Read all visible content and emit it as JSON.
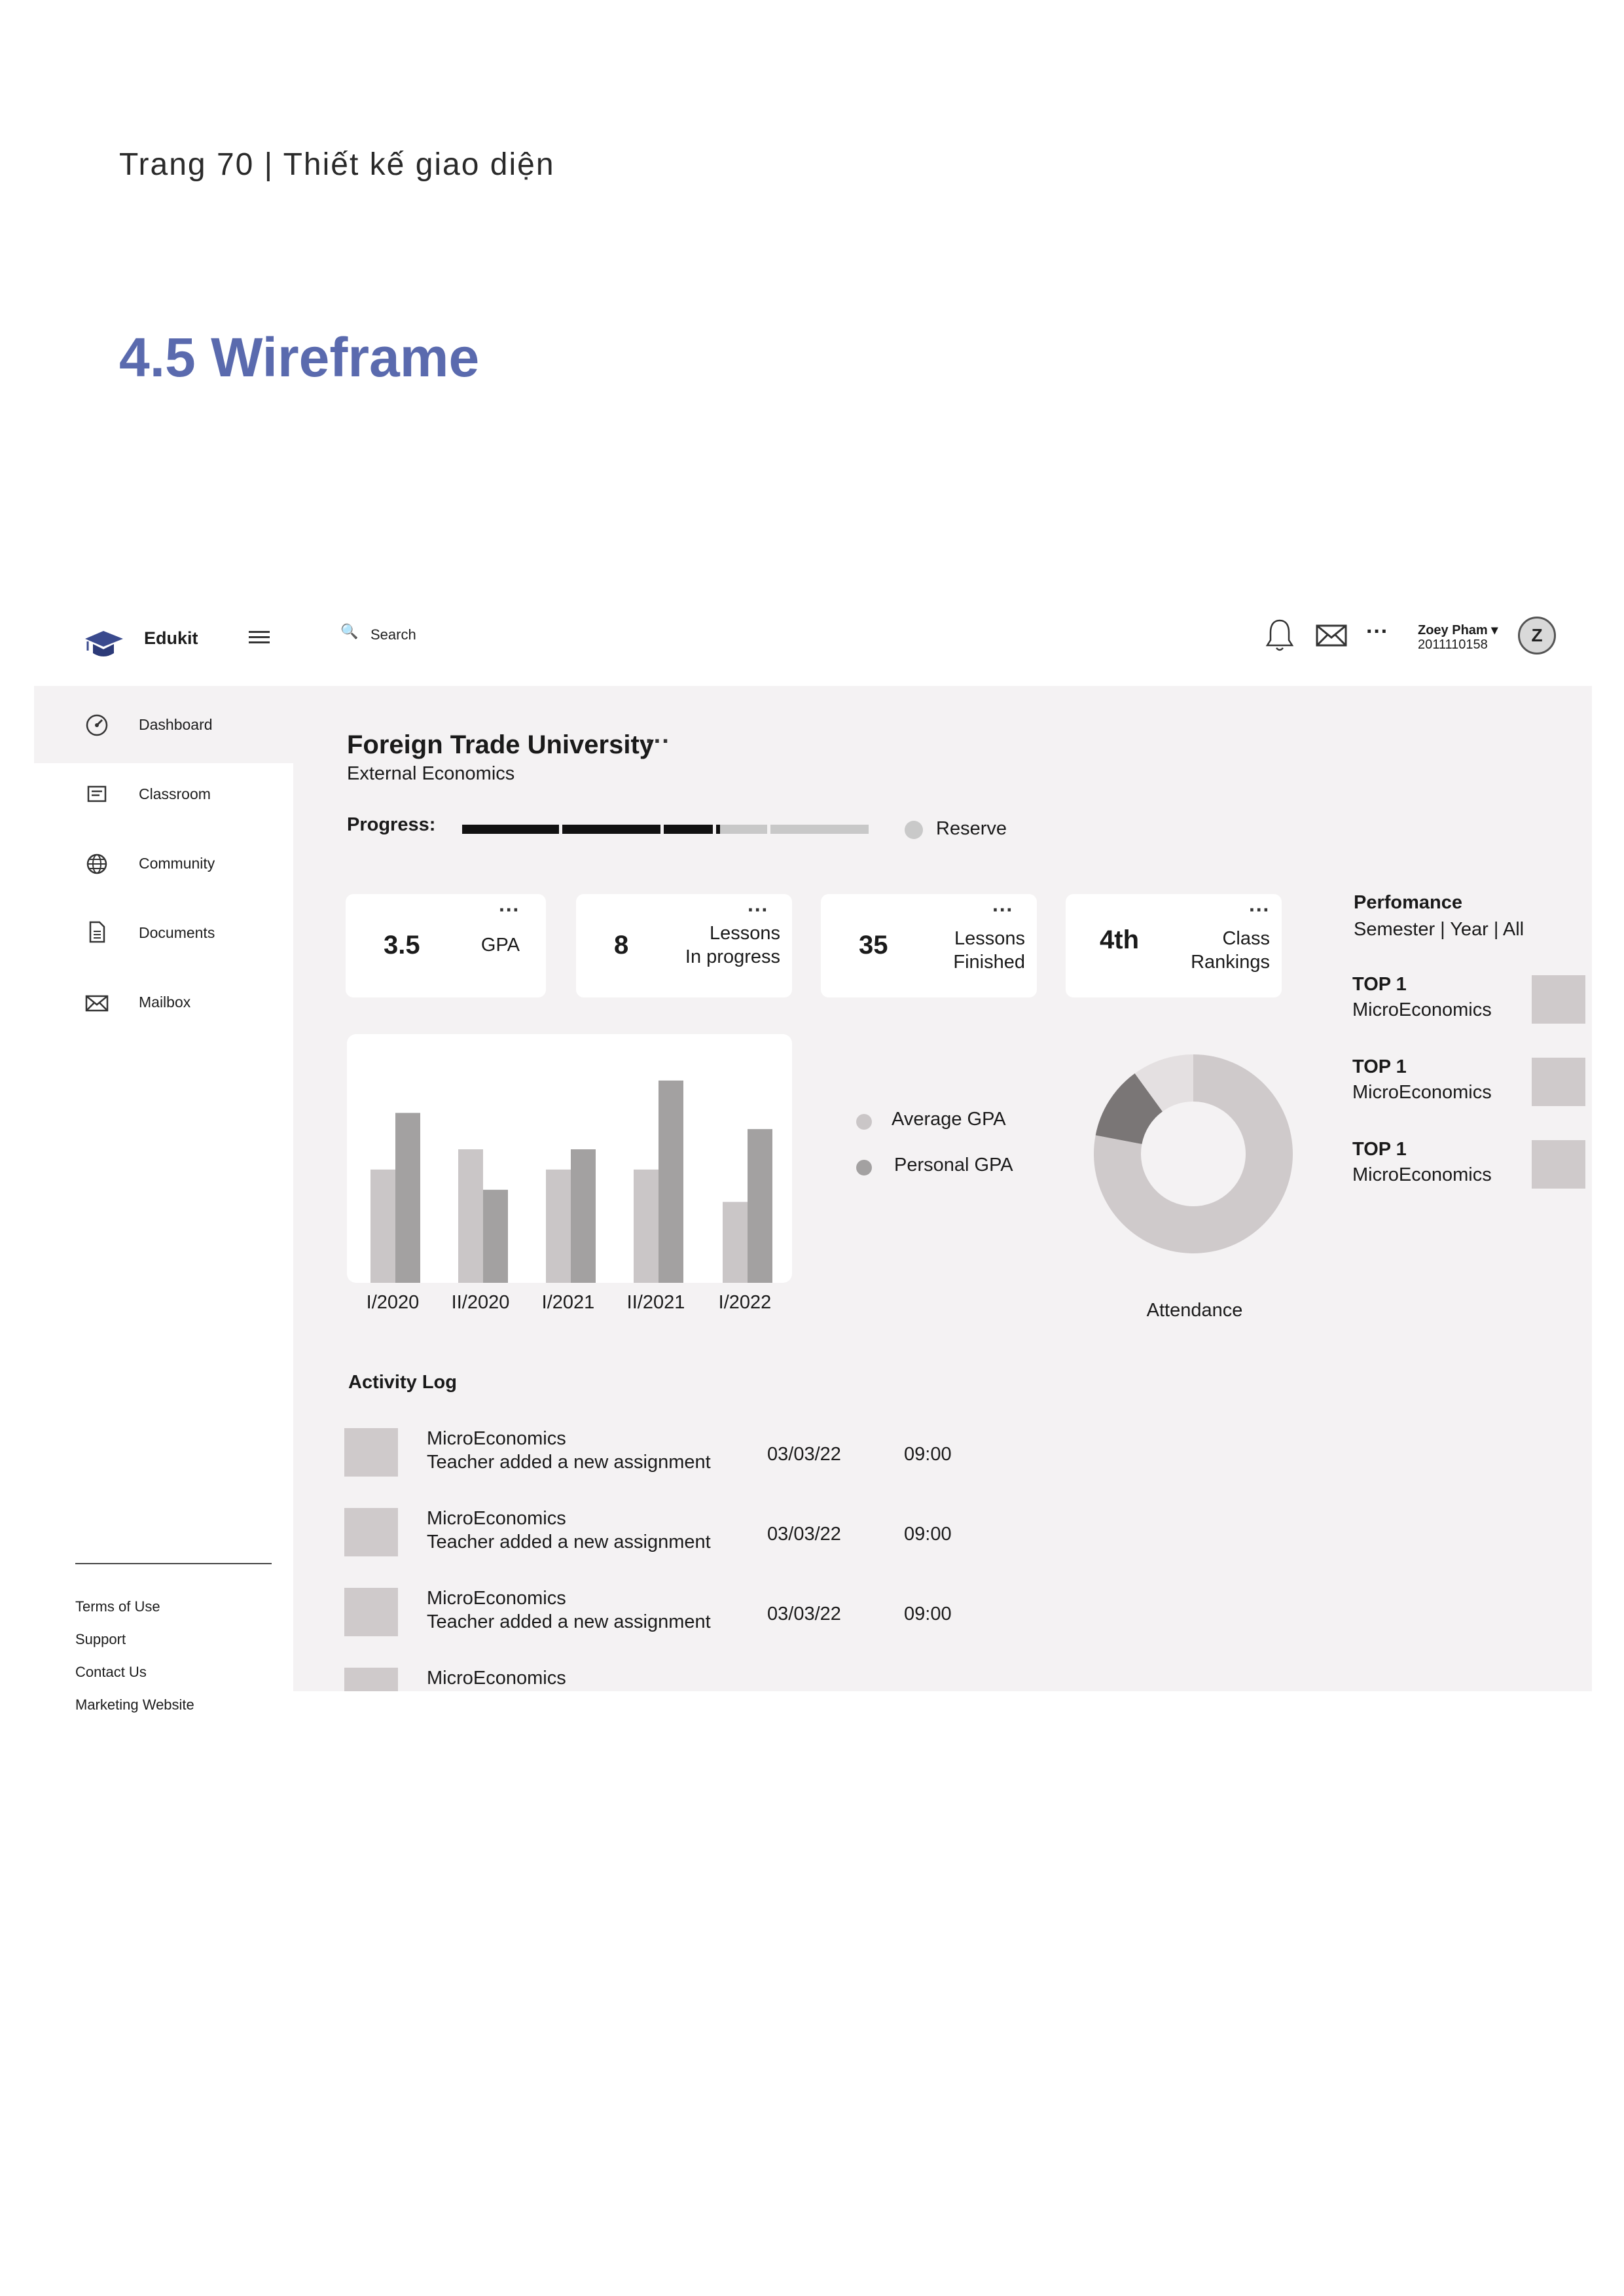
{
  "page": {
    "header": "Trang 70 | Thiết kế giao diện",
    "section_title": "4.5 Wireframe"
  },
  "app": {
    "name": "Edukit",
    "search_label": "Search",
    "user": {
      "name": "Zoey Pham ▾",
      "id": "2011110158",
      "avatar_initial": "Z"
    },
    "icons": [
      "logo-icon",
      "hamburger-menu-icon",
      "search-icon",
      "bell-icon",
      "mail-icon",
      "more-icon"
    ]
  },
  "sidebar": {
    "items": [
      {
        "label": "Dashboard",
        "icon": "dashboard-icon",
        "active": true
      },
      {
        "label": "Classroom",
        "icon": "classroom-icon",
        "active": false
      },
      {
        "label": "Community",
        "icon": "globe-icon",
        "active": false
      },
      {
        "label": "Documents",
        "icon": "document-icon",
        "active": false
      },
      {
        "label": "Mailbox",
        "icon": "mailbox-icon",
        "active": false
      }
    ],
    "footer_links": [
      "Terms of Use",
      "Support",
      "Contact Us",
      "Marketing Website"
    ]
  },
  "main": {
    "university": "Foreign Trade University",
    "department": "External Economics",
    "progress_label": "Progress:",
    "progress_completed_fraction": 0.63,
    "reserve_label": "Reserve",
    "stats": [
      {
        "value": "3.5",
        "label_line1": "GPA",
        "label_line2": ""
      },
      {
        "value": "8",
        "label_line1": "Lessons",
        "label_line2": "In progress"
      },
      {
        "value": "35",
        "label_line1": "Lessons",
        "label_line2": "Finished"
      },
      {
        "value": "4th",
        "label_line1": "Class",
        "label_line2": "Rankings"
      }
    ],
    "performance": {
      "title": "Perfomance",
      "filter": "Semester | Year | All",
      "items": [
        {
          "rank": "TOP 1",
          "course": "MicroEconomics"
        },
        {
          "rank": "TOP 1",
          "course": "MicroEconomics"
        },
        {
          "rank": "TOP 1",
          "course": "MicroEconomics"
        }
      ]
    },
    "legend": {
      "average": "Average GPA",
      "personal": "Personal GPA"
    },
    "attendance_label": "Attendance",
    "activity_log": {
      "title": "Activity Log",
      "rows": [
        {
          "course": "MicroEconomics",
          "message": "Teacher added a new assignment",
          "date": "03/03/22",
          "time": "09:00"
        },
        {
          "course": "MicroEconomics",
          "message": "Teacher added a new assignment",
          "date": "03/03/22",
          "time": "09:00"
        },
        {
          "course": "MicroEconomics",
          "message": "Teacher added a new assignment",
          "date": "03/03/22",
          "time": "09:00"
        },
        {
          "course": "MicroEconomics",
          "message": "",
          "date": "",
          "time": ""
        }
      ]
    }
  },
  "chart_data": [
    {
      "type": "bar",
      "categories": [
        "I/2020",
        "II/2020",
        "I/2021",
        "II/2021",
        "I/2022"
      ],
      "series": [
        {
          "name": "Average GPA",
          "color": "#cac6c7",
          "values": [
            2.8,
            3.3,
            2.8,
            2.8,
            2.0
          ]
        },
        {
          "name": "Personal GPA",
          "color": "#a3a1a1",
          "values": [
            4.2,
            2.3,
            3.3,
            5.0,
            3.8
          ]
        }
      ],
      "ylim": [
        0,
        5.5
      ]
    },
    {
      "type": "pie",
      "title": "Attendance",
      "slices": [
        {
          "value": 0.78,
          "color": "#cfcacb"
        },
        {
          "value": 0.12,
          "color": "#7a7676"
        },
        {
          "value": 0.1,
          "color": "#e4e0e1"
        }
      ]
    }
  ],
  "colors": {
    "accent": "#5a6aae",
    "panel_bg": "#f4f2f3",
    "placeholder": "#cfcacb",
    "progress_done": "#111111",
    "progress_todo": "#c8c8c8"
  }
}
